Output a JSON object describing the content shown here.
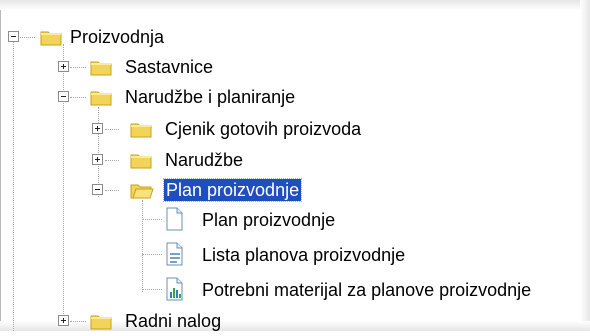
{
  "tree": {
    "nodes": [
      {
        "id": "proizvodnja",
        "label": "Proizvodnja",
        "expanded": true,
        "icon": "folder-icon"
      },
      {
        "id": "sastavnice",
        "label": "Sastavnice",
        "expanded": false,
        "icon": "folder-icon"
      },
      {
        "id": "narudzbe_planiranje",
        "label": "Narudžbe i planiranje",
        "expanded": true,
        "icon": "folder-icon"
      },
      {
        "id": "cjenik",
        "label": "Cjenik gotovih proizvoda",
        "expanded": false,
        "icon": "folder-icon"
      },
      {
        "id": "narudzbe",
        "label": "Narudžbe",
        "expanded": false,
        "icon": "folder-icon"
      },
      {
        "id": "plan_proizvodnje_folder",
        "label": "Plan proizvodnje",
        "expanded": true,
        "selected": true,
        "icon": "folder-open-icon"
      },
      {
        "id": "plan_proizvodnje_doc",
        "label": "Plan proizvodnje",
        "icon": "document-icon"
      },
      {
        "id": "lista_planova",
        "label": "Lista planova proizvodnje",
        "icon": "list-document-icon"
      },
      {
        "id": "potrebni_materijal",
        "label": "Potrebni materijal za planove proizvodnje",
        "icon": "chart-document-icon"
      },
      {
        "id": "radni_nalog",
        "label": "Radni nalog",
        "expanded": false,
        "icon": "folder-icon"
      }
    ]
  },
  "colors": {
    "selection_bg": "#1f4fbf",
    "selection_text": "#ffffff",
    "folder_yellow": "#f3d45a",
    "folder_outline": "#c8a11b",
    "lines": "#a7a7a7"
  }
}
